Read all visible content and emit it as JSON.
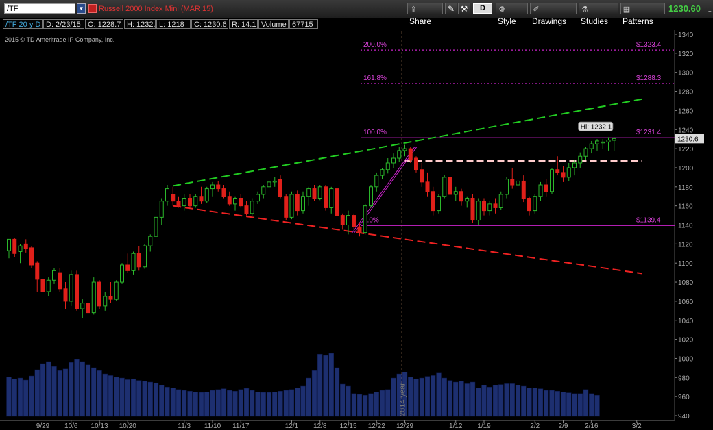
{
  "toolbar": {
    "symbol": "/TF",
    "description": "Russell 2000 Index Mini (MAR 15)",
    "share": "Share",
    "aggregation": "D",
    "style": "Style",
    "drawings": "Drawings",
    "studies": "Studies",
    "patterns": "Patterns",
    "last_price": "1230.60"
  },
  "info": {
    "period": "/TF 20 y D",
    "date": "D: 2/23/15",
    "open": "O: 1228.7",
    "high": "H: 1232.1",
    "low": "L: 1218",
    "close": "C: 1230.6",
    "range": "R: 14.1",
    "volume_label": "Volume",
    "volume": "67715"
  },
  "copyright": "2015 © TD Ameritrade IP Company, Inc.",
  "chart_data": {
    "type": "candlestick",
    "y_ticks": [
      1340,
      1320,
      1300,
      1280,
      1260,
      1240,
      1220,
      1200,
      1180,
      1160,
      1140,
      1120,
      1100,
      1080,
      1060,
      1040,
      1020,
      1000,
      980,
      960,
      940
    ],
    "ylim": [
      940,
      1345
    ],
    "x_ticks": [
      {
        "label": "9/29",
        "idx": 6
      },
      {
        "label": "10/6",
        "idx": 11
      },
      {
        "label": "10/13",
        "idx": 16
      },
      {
        "label": "10/20",
        "idx": 21
      },
      {
        "label": "11/3",
        "idx": 31
      },
      {
        "label": "11/10",
        "idx": 36
      },
      {
        "label": "11/17",
        "idx": 41
      },
      {
        "label": "12/1",
        "idx": 50
      },
      {
        "label": "12/8",
        "idx": 55
      },
      {
        "label": "12/15",
        "idx": 60
      },
      {
        "label": "12/22",
        "idx": 65
      },
      {
        "label": "12/29",
        "idx": 70
      },
      {
        "label": "1/12",
        "idx": 79
      },
      {
        "label": "1/19",
        "idx": 84
      },
      {
        "label": "2/2",
        "idx": 93
      },
      {
        "label": "2/9",
        "idx": 98
      },
      {
        "label": "2/16",
        "idx": 103
      },
      {
        "label": "3/2",
        "idx": 111
      }
    ],
    "year_marker": {
      "label": "2014 year",
      "idx": 69
    },
    "last_price_label": "1230.6",
    "high_label": "Hi: 1232.1",
    "fib_levels": [
      {
        "pct": "200.0%",
        "price": "$1323.4",
        "value": 1323.4,
        "style": "dotted"
      },
      {
        "pct": "161.8%",
        "price": "$1288.3",
        "value": 1288.3,
        "style": "dotted"
      },
      {
        "pct": "100.0%",
        "price": "$1231.4",
        "value": 1231.4,
        "style": "solid"
      },
      {
        "pct": "0.0%",
        "price": "$1139.4",
        "value": 1139.4,
        "style": "solid"
      }
    ],
    "trendlines": [
      {
        "name": "upper",
        "color": "#22cc22",
        "from": {
          "idx": 29,
          "value": 1181
        },
        "to": {
          "idx": 112,
          "value": 1272
        }
      },
      {
        "name": "lower",
        "color": "#ee2222",
        "from": {
          "idx": 29,
          "value": 1160
        },
        "to": {
          "idx": 112,
          "value": 1089
        }
      },
      {
        "name": "resistance",
        "color": "#ffcccc",
        "from": {
          "idx": 70,
          "value": 1207
        },
        "to": {
          "idx": 112,
          "value": 1207
        }
      }
    ],
    "candles": [
      {
        "o": 1113,
        "h": 1125,
        "l": 1105,
        "c": 1125
      },
      {
        "o": 1125,
        "h": 1126,
        "l": 1106,
        "c": 1110
      },
      {
        "o": 1112,
        "h": 1120,
        "l": 1100,
        "c": 1118
      },
      {
        "o": 1120,
        "h": 1125,
        "l": 1111,
        "c": 1115
      },
      {
        "o": 1116,
        "h": 1118,
        "l": 1095,
        "c": 1098
      },
      {
        "o": 1100,
        "h": 1102,
        "l": 1070,
        "c": 1083
      },
      {
        "o": 1083,
        "h": 1085,
        "l": 1060,
        "c": 1070
      },
      {
        "o": 1070,
        "h": 1085,
        "l": 1065,
        "c": 1082
      },
      {
        "o": 1082,
        "h": 1095,
        "l": 1078,
        "c": 1092
      },
      {
        "o": 1090,
        "h": 1095,
        "l": 1070,
        "c": 1073
      },
      {
        "o": 1073,
        "h": 1080,
        "l": 1052,
        "c": 1060
      },
      {
        "o": 1060,
        "h": 1092,
        "l": 1055,
        "c": 1088
      },
      {
        "o": 1088,
        "h": 1092,
        "l": 1050,
        "c": 1052
      },
      {
        "o": 1052,
        "h": 1062,
        "l": 1042,
        "c": 1058
      },
      {
        "o": 1058,
        "h": 1070,
        "l": 1045,
        "c": 1048
      },
      {
        "o": 1048,
        "h": 1085,
        "l": 1046,
        "c": 1080
      },
      {
        "o": 1080,
        "h": 1082,
        "l": 1052,
        "c": 1055
      },
      {
        "o": 1055,
        "h": 1070,
        "l": 1050,
        "c": 1065
      },
      {
        "o": 1065,
        "h": 1080,
        "l": 1058,
        "c": 1062
      },
      {
        "o": 1062,
        "h": 1082,
        "l": 1060,
        "c": 1080
      },
      {
        "o": 1080,
        "h": 1100,
        "l": 1078,
        "c": 1098
      },
      {
        "o": 1098,
        "h": 1110,
        "l": 1090,
        "c": 1092
      },
      {
        "o": 1092,
        "h": 1112,
        "l": 1088,
        "c": 1110
      },
      {
        "o": 1110,
        "h": 1118,
        "l": 1092,
        "c": 1096
      },
      {
        "o": 1096,
        "h": 1120,
        "l": 1094,
        "c": 1118
      },
      {
        "o": 1118,
        "h": 1130,
        "l": 1112,
        "c": 1128
      },
      {
        "o": 1128,
        "h": 1150,
        "l": 1126,
        "c": 1148
      },
      {
        "o": 1148,
        "h": 1168,
        "l": 1140,
        "c": 1165
      },
      {
        "o": 1165,
        "h": 1182,
        "l": 1160,
        "c": 1178
      },
      {
        "o": 1172,
        "h": 1180,
        "l": 1160,
        "c": 1165
      },
      {
        "o": 1165,
        "h": 1170,
        "l": 1158,
        "c": 1160
      },
      {
        "o": 1160,
        "h": 1172,
        "l": 1155,
        "c": 1168
      },
      {
        "o": 1168,
        "h": 1172,
        "l": 1158,
        "c": 1160
      },
      {
        "o": 1160,
        "h": 1172,
        "l": 1158,
        "c": 1170
      },
      {
        "o": 1170,
        "h": 1180,
        "l": 1162,
        "c": 1165
      },
      {
        "o": 1165,
        "h": 1180,
        "l": 1163,
        "c": 1178
      },
      {
        "o": 1178,
        "h": 1185,
        "l": 1170,
        "c": 1182
      },
      {
        "o": 1182,
        "h": 1186,
        "l": 1175,
        "c": 1178
      },
      {
        "o": 1178,
        "h": 1182,
        "l": 1168,
        "c": 1170
      },
      {
        "o": 1170,
        "h": 1175,
        "l": 1160,
        "c": 1162
      },
      {
        "o": 1162,
        "h": 1170,
        "l": 1155,
        "c": 1168
      },
      {
        "o": 1168,
        "h": 1172,
        "l": 1158,
        "c": 1160
      },
      {
        "o": 1160,
        "h": 1165,
        "l": 1150,
        "c": 1152
      },
      {
        "o": 1152,
        "h": 1168,
        "l": 1150,
        "c": 1165
      },
      {
        "o": 1165,
        "h": 1175,
        "l": 1162,
        "c": 1172
      },
      {
        "o": 1172,
        "h": 1182,
        "l": 1168,
        "c": 1180
      },
      {
        "o": 1180,
        "h": 1188,
        "l": 1176,
        "c": 1185
      },
      {
        "o": 1185,
        "h": 1190,
        "l": 1180,
        "c": 1186
      },
      {
        "o": 1188,
        "h": 1192,
        "l": 1168,
        "c": 1170
      },
      {
        "o": 1170,
        "h": 1172,
        "l": 1145,
        "c": 1148
      },
      {
        "o": 1148,
        "h": 1175,
        "l": 1146,
        "c": 1172
      },
      {
        "o": 1172,
        "h": 1176,
        "l": 1150,
        "c": 1155
      },
      {
        "o": 1155,
        "h": 1175,
        "l": 1152,
        "c": 1170
      },
      {
        "o": 1170,
        "h": 1180,
        "l": 1160,
        "c": 1178
      },
      {
        "o": 1178,
        "h": 1182,
        "l": 1165,
        "c": 1168
      },
      {
        "o": 1168,
        "h": 1182,
        "l": 1166,
        "c": 1180
      },
      {
        "o": 1180,
        "h": 1182,
        "l": 1155,
        "c": 1158
      },
      {
        "o": 1158,
        "h": 1180,
        "l": 1152,
        "c": 1178
      },
      {
        "o": 1178,
        "h": 1180,
        "l": 1148,
        "c": 1150
      },
      {
        "o": 1150,
        "h": 1152,
        "l": 1135,
        "c": 1140
      },
      {
        "o": 1140,
        "h": 1155,
        "l": 1130,
        "c": 1150
      },
      {
        "o": 1150,
        "h": 1152,
        "l": 1135,
        "c": 1138
      },
      {
        "o": 1138,
        "h": 1142,
        "l": 1128,
        "c": 1132
      },
      {
        "o": 1132,
        "h": 1162,
        "l": 1130,
        "c": 1160
      },
      {
        "o": 1160,
        "h": 1182,
        "l": 1158,
        "c": 1180
      },
      {
        "o": 1180,
        "h": 1195,
        "l": 1175,
        "c": 1192
      },
      {
        "o": 1192,
        "h": 1200,
        "l": 1188,
        "c": 1198
      },
      {
        "o": 1198,
        "h": 1210,
        "l": 1194,
        "c": 1205
      },
      {
        "o": 1205,
        "h": 1215,
        "l": 1200,
        "c": 1210
      },
      {
        "o": 1210,
        "h": 1222,
        "l": 1206,
        "c": 1218
      },
      {
        "o": 1218,
        "h": 1224,
        "l": 1212,
        "c": 1220
      },
      {
        "o": 1220,
        "h": 1222,
        "l": 1205,
        "c": 1208
      },
      {
        "o": 1210,
        "h": 1212,
        "l": 1195,
        "c": 1198
      },
      {
        "o": 1198,
        "h": 1205,
        "l": 1180,
        "c": 1185
      },
      {
        "o": 1185,
        "h": 1195,
        "l": 1170,
        "c": 1175
      },
      {
        "o": 1175,
        "h": 1180,
        "l": 1150,
        "c": 1155
      },
      {
        "o": 1155,
        "h": 1172,
        "l": 1152,
        "c": 1170
      },
      {
        "o": 1170,
        "h": 1192,
        "l": 1168,
        "c": 1190
      },
      {
        "o": 1190,
        "h": 1192,
        "l": 1168,
        "c": 1172
      },
      {
        "o": 1172,
        "h": 1180,
        "l": 1165,
        "c": 1175
      },
      {
        "o": 1175,
        "h": 1178,
        "l": 1160,
        "c": 1165
      },
      {
        "o": 1165,
        "h": 1170,
        "l": 1158,
        "c": 1168
      },
      {
        "o": 1168,
        "h": 1172,
        "l": 1142,
        "c": 1145
      },
      {
        "o": 1145,
        "h": 1168,
        "l": 1140,
        "c": 1165
      },
      {
        "o": 1165,
        "h": 1168,
        "l": 1150,
        "c": 1155
      },
      {
        "o": 1155,
        "h": 1165,
        "l": 1150,
        "c": 1162
      },
      {
        "o": 1162,
        "h": 1168,
        "l": 1152,
        "c": 1158
      },
      {
        "o": 1158,
        "h": 1175,
        "l": 1156,
        "c": 1172
      },
      {
        "o": 1172,
        "h": 1190,
        "l": 1168,
        "c": 1188
      },
      {
        "o": 1188,
        "h": 1200,
        "l": 1178,
        "c": 1182
      },
      {
        "o": 1182,
        "h": 1190,
        "l": 1172,
        "c": 1186
      },
      {
        "o": 1186,
        "h": 1192,
        "l": 1164,
        "c": 1168
      },
      {
        "o": 1168,
        "h": 1170,
        "l": 1150,
        "c": 1155
      },
      {
        "o": 1155,
        "h": 1172,
        "l": 1152,
        "c": 1170
      },
      {
        "o": 1170,
        "h": 1185,
        "l": 1165,
        "c": 1182
      },
      {
        "o": 1182,
        "h": 1188,
        "l": 1170,
        "c": 1175
      },
      {
        "o": 1175,
        "h": 1200,
        "l": 1172,
        "c": 1198
      },
      {
        "o": 1198,
        "h": 1212,
        "l": 1192,
        "c": 1195
      },
      {
        "o": 1195,
        "h": 1202,
        "l": 1185,
        "c": 1190
      },
      {
        "o": 1190,
        "h": 1205,
        "l": 1186,
        "c": 1200
      },
      {
        "o": 1200,
        "h": 1208,
        "l": 1192,
        "c": 1205
      },
      {
        "o": 1205,
        "h": 1216,
        "l": 1200,
        "c": 1212
      },
      {
        "o": 1212,
        "h": 1222,
        "l": 1208,
        "c": 1220
      },
      {
        "o": 1220,
        "h": 1228,
        "l": 1215,
        "c": 1225
      },
      {
        "o": 1225,
        "h": 1230,
        "l": 1218,
        "c": 1228
      },
      {
        "o": 1226,
        "h": 1230,
        "l": 1220,
        "c": 1227
      },
      {
        "o": 1227,
        "h": 1232,
        "l": 1218,
        "c": 1229
      },
      {
        "o": 1228.7,
        "h": 1232.1,
        "l": 1218,
        "c": 1230.6
      }
    ],
    "volume": [
      92,
      88,
      90,
      85,
      95,
      110,
      125,
      130,
      118,
      108,
      112,
      128,
      135,
      130,
      122,
      115,
      108,
      100,
      96,
      92,
      90,
      86,
      88,
      84,
      82,
      80,
      78,
      72,
      68,
      66,
      62,
      60,
      58,
      56,
      55,
      56,
      60,
      62,
      64,
      60,
      58,
      62,
      65,
      60,
      56,
      55,
      55,
      56,
      58,
      60,
      62,
      66,
      70,
      90,
      108,
      148,
      145,
      150,
      115,
      75,
      70,
      52,
      50,
      48,
      52,
      56,
      60,
      62,
      90,
      100,
      104,
      92,
      88,
      90,
      94,
      96,
      102,
      90,
      84,
      80,
      82,
      76,
      80,
      66,
      72,
      68,
      72,
      74,
      76,
      76,
      72,
      70,
      66,
      66,
      64,
      60,
      60,
      58,
      56,
      54,
      52,
      52,
      62,
      52,
      48
    ]
  }
}
